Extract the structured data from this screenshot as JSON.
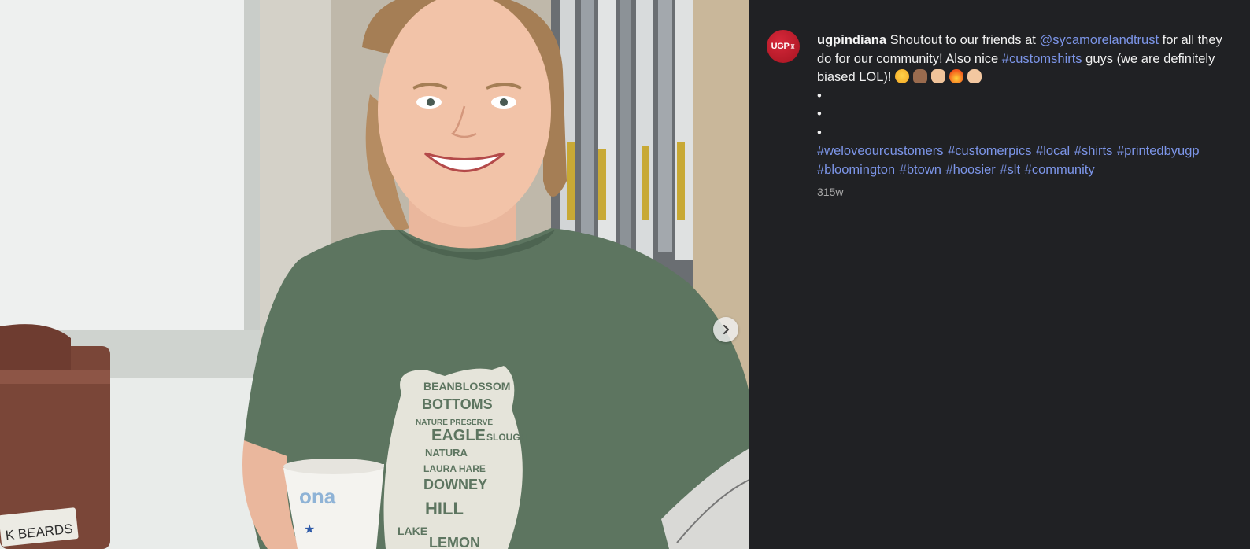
{
  "post": {
    "username": "ugpindiana",
    "avatar_text": "UGP",
    "caption_parts": {
      "lead": "Shoutout to our friends at",
      "mention": "@sycamorelandtrust",
      "mid": "for all they do for our community! Also nice",
      "hashtag_inline": "#customshirts",
      "tail": "guys (we are definitely biased LOL)!"
    },
    "emojis": [
      "smirk-emoji",
      "raised-hands-emoji",
      "thumbs-up-emoji",
      "fire-emoji",
      "ok-hand-emoji"
    ],
    "dots": [
      "•",
      "•",
      "•"
    ],
    "hashtags": [
      "#weloveourcustomers",
      "#customerpics",
      "#local",
      "#shirts",
      "#printedbyugp",
      "#bloomington",
      "#btown",
      "#hoosier",
      "#slt",
      "#community"
    ],
    "timestamp": "315w"
  },
  "photo": {
    "sign_text": "K BEARDS",
    "shirt_words": [
      "BEANBLOSSOM",
      "BOTTOMS",
      "NATURE PRESERVE",
      "EAGLE",
      "SLOUGH",
      "NATURA",
      "LAURA HARE",
      "DOWNEY",
      "HILL",
      "LAKE",
      "LEMON"
    ],
    "cup_text": "ona"
  },
  "colors": {
    "background": "#202124",
    "link": "#7c95e8",
    "avatar": "#c41e30",
    "shirt": "#5d7560"
  }
}
